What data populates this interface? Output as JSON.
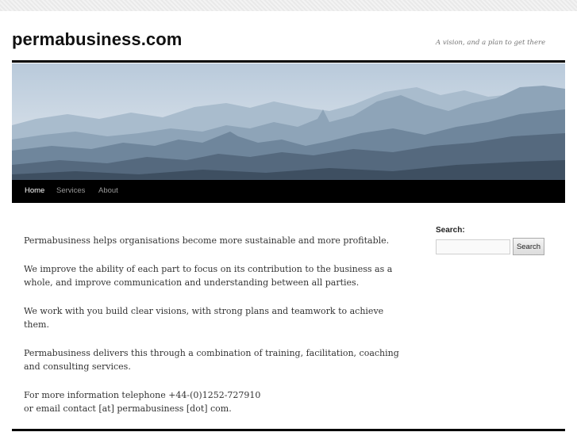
{
  "header": {
    "site_title": "permabusiness.com",
    "tagline": "A vision, and a plan to get there"
  },
  "nav": {
    "items": [
      {
        "label": "Home",
        "active": true
      },
      {
        "label": "Services",
        "active": false
      },
      {
        "label": "About",
        "active": false
      }
    ]
  },
  "main": {
    "paragraphs": [
      "Permabusiness helps organisations become more sustainable and more profitable.",
      "We improve the ability of each part to focus on its contribution to the business as a whole, and improve communication and understanding between all parties.",
      "We work with you build clear visions, with strong plans and teamwork to achieve them.",
      "Permabusiness delivers this through a combination of training, facilitation, coaching and consulting services."
    ],
    "contact_line_1": "For more information telephone +44-(0)1252-727910",
    "contact_line_2": "or email contact [at] permabusiness [dot] com."
  },
  "sidebar": {
    "search_title": "Search:",
    "search_value": "",
    "search_button": "Search"
  },
  "colors": {
    "nav_background": "#000000",
    "nav_active": "#ffffff",
    "nav_inactive": "#9a9a9a",
    "text": "#333333"
  }
}
